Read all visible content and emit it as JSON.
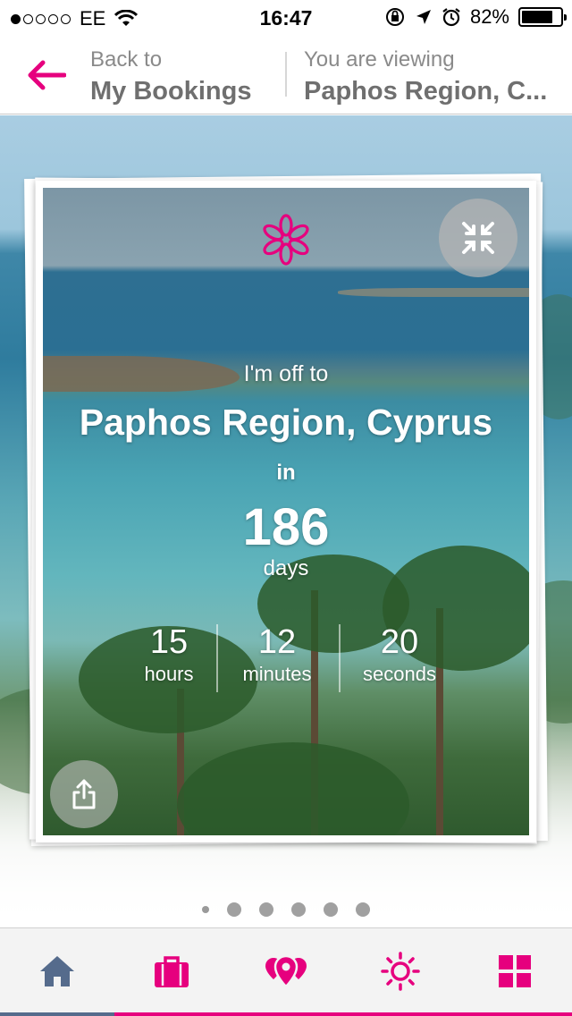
{
  "status_bar": {
    "carrier": "EE",
    "time": "16:47",
    "battery": "82%",
    "battery_level": 0.82
  },
  "header": {
    "back_small": "Back to",
    "back_big": "My Bookings",
    "viewing_small": "You are viewing",
    "viewing_big": "Paphos Region, C..."
  },
  "card": {
    "off_to": "I'm off to",
    "destination": "Paphos Region, Cyprus",
    "in_label": "in",
    "days": "186",
    "days_label": "days",
    "hours": "15",
    "hours_label": "hours",
    "minutes": "12",
    "minutes_label": "minutes",
    "seconds": "20",
    "seconds_label": "seconds"
  },
  "pager": {
    "pages": 6,
    "current": 0
  },
  "tabs": [
    {
      "icon": "home-icon",
      "active": true
    },
    {
      "icon": "suitcase-icon",
      "active": false
    },
    {
      "icon": "map-pins-icon",
      "active": false
    },
    {
      "icon": "sun-icon",
      "active": false
    },
    {
      "icon": "grid-icon",
      "active": false
    }
  ],
  "colors": {
    "accent": "#e6007e",
    "active_tab": "#556b8c"
  }
}
